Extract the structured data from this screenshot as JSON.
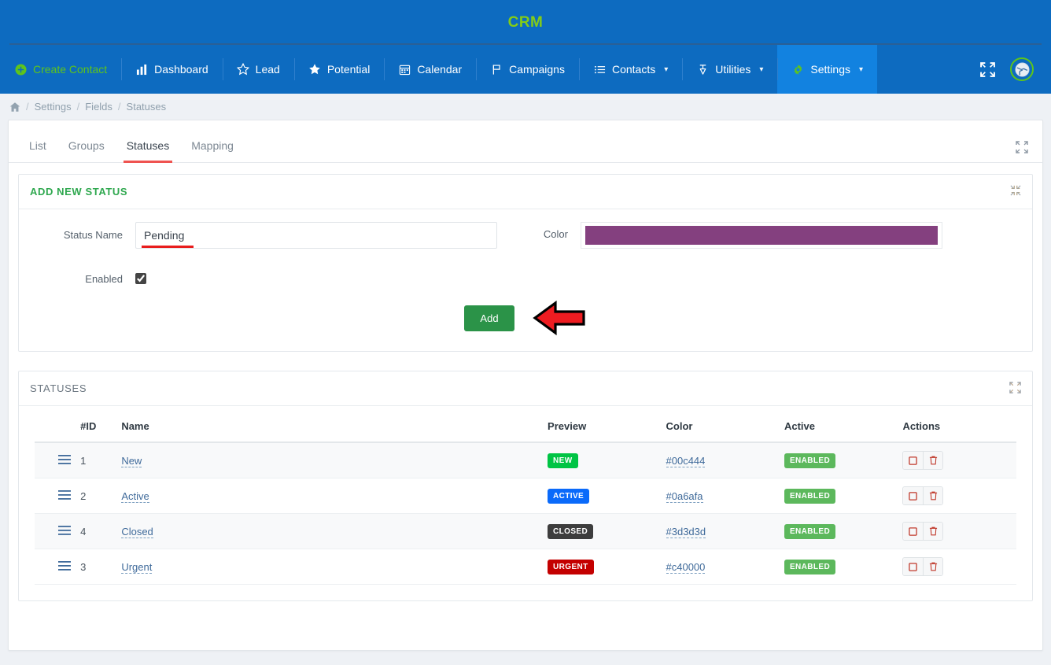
{
  "brand": {
    "title": "CRM"
  },
  "nav": {
    "items": [
      {
        "label": "Create Contact",
        "icon": "plus-circle-icon",
        "style": "green",
        "caret": false
      },
      {
        "label": "Dashboard",
        "icon": "chart-bar-icon",
        "style": "plain",
        "caret": false
      },
      {
        "label": "Lead",
        "icon": "star-outline-icon",
        "style": "plain",
        "caret": false
      },
      {
        "label": "Potential",
        "icon": "star-filled-icon",
        "style": "plain",
        "caret": false
      },
      {
        "label": "Calendar",
        "icon": "calendar-icon",
        "style": "plain",
        "caret": false
      },
      {
        "label": "Campaigns",
        "icon": "flag-icon",
        "style": "plain",
        "caret": false
      },
      {
        "label": "Contacts",
        "icon": "list-icon",
        "style": "plain",
        "caret": true
      },
      {
        "label": "Utilities",
        "icon": "pin-icon",
        "style": "plain",
        "caret": true
      },
      {
        "label": "Settings",
        "icon": "gear-icon",
        "style": "active",
        "caret": true
      }
    ],
    "right": {
      "fullscreen_icon": "expand-arrows-icon",
      "globe_icon": "globe-icon"
    }
  },
  "breadcrumb": {
    "home_icon": "home-icon",
    "items": [
      "Settings",
      "Fields",
      "Statuses"
    ],
    "separator": "/"
  },
  "tabs": {
    "items": [
      {
        "label": "List",
        "active": false
      },
      {
        "label": "Groups",
        "active": false
      },
      {
        "label": "Statuses",
        "active": true
      },
      {
        "label": "Mapping",
        "active": false
      }
    ],
    "expand_icon": "expand-icon"
  },
  "add_panel": {
    "title": "ADD NEW STATUS",
    "collapse_icon": "compress-icon",
    "status_name_label": "Status Name",
    "status_name_value": "Pending",
    "color_label": "Color",
    "color_value": "#84407f",
    "enabled_label": "Enabled",
    "enabled_checked": true,
    "add_button": "Add",
    "annotation": {
      "arrow": "left-arrow-pointer",
      "underline": "red-underline"
    }
  },
  "statuses_panel": {
    "title": "STATUSES",
    "expand_icon": "expand-icon",
    "columns": [
      "",
      "#ID",
      "Name",
      "Preview",
      "Color",
      "Active",
      "Actions"
    ],
    "rows": [
      {
        "handle": "drag-handle-icon",
        "id": "1",
        "name": "New",
        "preview": "NEW",
        "preview_color": "#00c444",
        "color": "#00c444",
        "active": "ENABLED",
        "actions": [
          "stop-icon",
          "trash-icon"
        ]
      },
      {
        "handle": "drag-handle-icon",
        "id": "2",
        "name": "Active",
        "preview": "ACTIVE",
        "preview_color": "#0a6afa",
        "color": "#0a6afa",
        "active": "ENABLED",
        "actions": [
          "stop-icon",
          "trash-icon"
        ]
      },
      {
        "handle": "drag-handle-icon",
        "id": "4",
        "name": "Closed",
        "preview": "CLOSED",
        "preview_color": "#3d3d3d",
        "color": "#3d3d3d",
        "active": "ENABLED",
        "actions": [
          "stop-icon",
          "trash-icon"
        ]
      },
      {
        "handle": "drag-handle-icon",
        "id": "3",
        "name": "Urgent",
        "preview": "URGENT",
        "preview_color": "#c40000",
        "color": "#c40000",
        "active": "ENABLED",
        "actions": [
          "stop-icon",
          "trash-icon"
        ]
      }
    ]
  },
  "colors": {
    "header_blue": "#0d6bc0",
    "active_nav_blue": "#1282e0",
    "brand_green": "#84cc16",
    "tab_accent_red": "#ef5350",
    "add_button_green": "#2b9348",
    "badge_enabled_green": "#5cb85c",
    "page_bg": "#eef1f5"
  }
}
